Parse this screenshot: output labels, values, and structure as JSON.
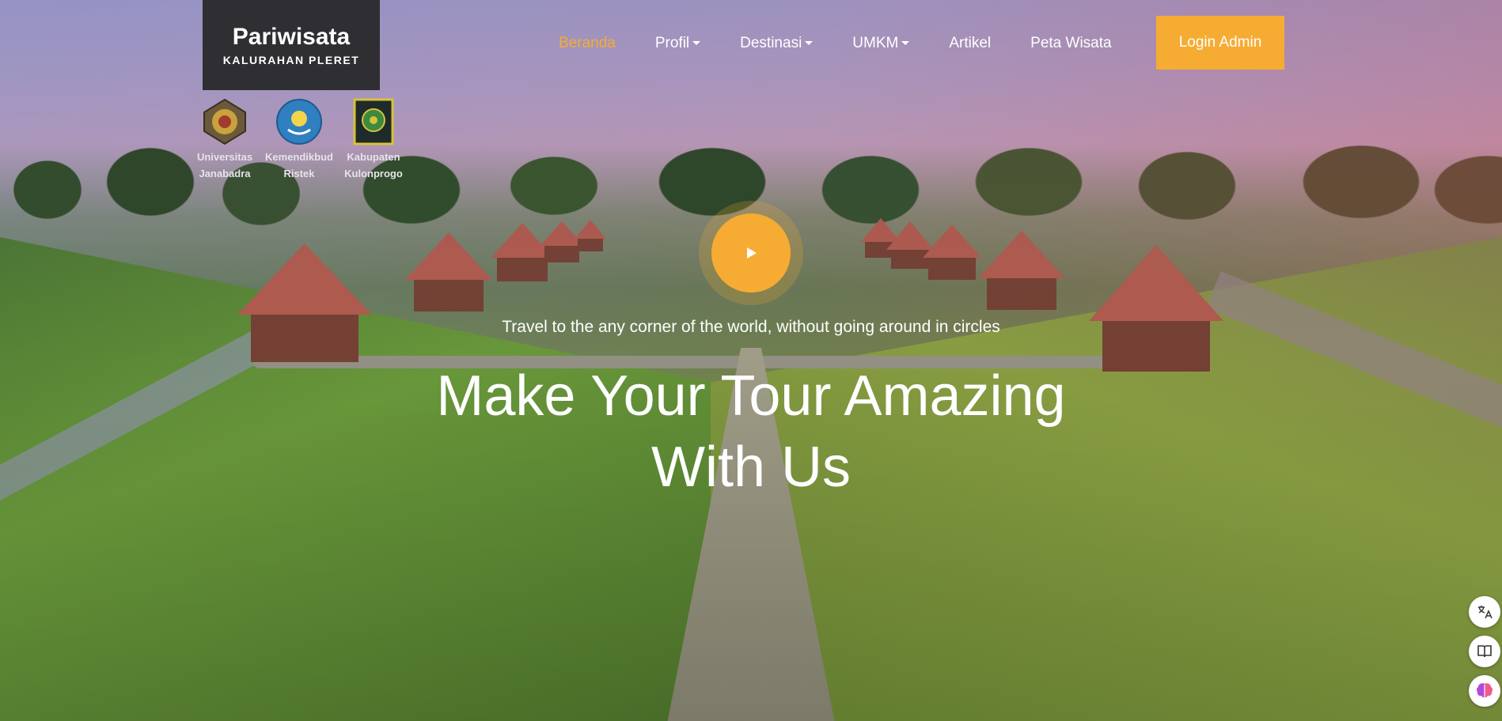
{
  "brand": {
    "title": "Pariwisata",
    "subtitle": "KALURAHAN PLERET"
  },
  "nav": {
    "home": "Beranda",
    "profile": "Profil",
    "destinations": "Destinasi",
    "umkm": "UMKM",
    "articles": "Artikel",
    "map": "Peta Wisata",
    "login": "Login Admin",
    "accent_color": "#f6ac32"
  },
  "partners": [
    {
      "line1": "Universitas",
      "line2": "Janabadra",
      "icon": "university-seal-icon"
    },
    {
      "line1": "Kemendikbud",
      "line2": "Ristek",
      "icon": "ministry-emblem-icon"
    },
    {
      "line1": "Kabupaten",
      "line2": "Kulonprogo",
      "icon": "regency-crest-icon"
    }
  ],
  "hero": {
    "tagline": "Travel to the any corner of the world, without going around in circles",
    "headline_line1": "Make Your Tour Amazing",
    "headline_line2": "With Us",
    "play_icon": "play-icon"
  },
  "widgets": [
    "translate-icon",
    "book-icon",
    "brain-icon"
  ]
}
